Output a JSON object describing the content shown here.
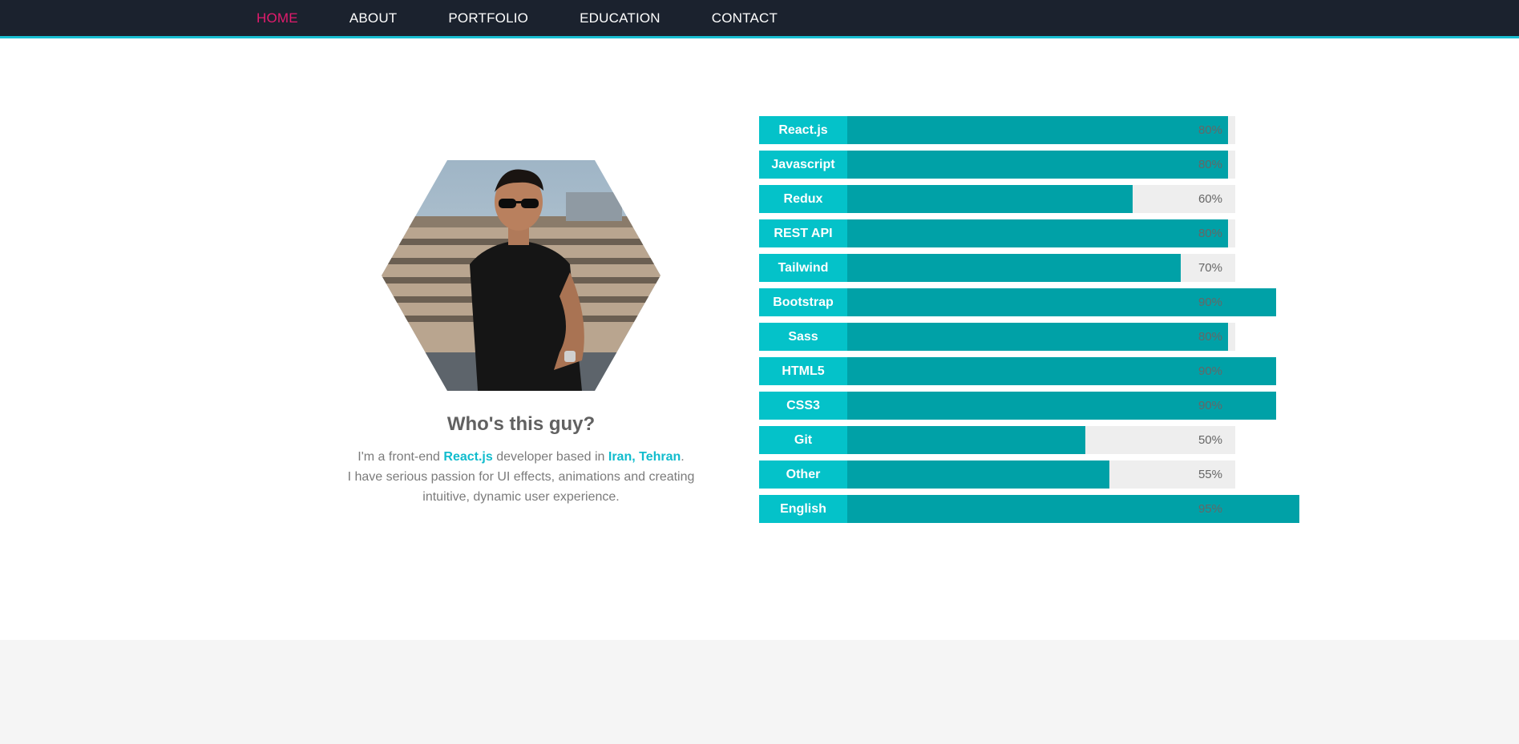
{
  "nav": {
    "items": [
      {
        "label": "HOME",
        "active": true
      },
      {
        "label": "ABOUT",
        "active": false
      },
      {
        "label": "PORTFOLIO",
        "active": false
      },
      {
        "label": "EDUCATION",
        "active": false
      },
      {
        "label": "CONTACT",
        "active": false
      }
    ]
  },
  "profile": {
    "title": "Who's this guy?",
    "bio": {
      "line1_pre": "I'm a front-end ",
      "tech": "React.js",
      "line1_mid": " developer based in ",
      "location": "Iran, Tehran",
      "line1_post": ".",
      "line2": "I have serious passion for UI effects, animations and creating intuitive, dynamic user experience."
    }
  },
  "skills": [
    {
      "name": "React.js",
      "percent": 80,
      "label": "80%"
    },
    {
      "name": "Javascript",
      "percent": 80,
      "label": "80%"
    },
    {
      "name": "Redux",
      "percent": 60,
      "label": "60%"
    },
    {
      "name": "REST API",
      "percent": 80,
      "label": "80%"
    },
    {
      "name": "Tailwind",
      "percent": 70,
      "label": "70%"
    },
    {
      "name": "Bootstrap",
      "percent": 90,
      "label": "90%"
    },
    {
      "name": "Sass",
      "percent": 80,
      "label": "80%"
    },
    {
      "name": "HTML5",
      "percent": 90,
      "label": "90%"
    },
    {
      "name": "CSS3",
      "percent": 90,
      "label": "90%"
    },
    {
      "name": "Git",
      "percent": 50,
      "label": "50%"
    },
    {
      "name": "Other",
      "percent": 55,
      "label": "55%"
    },
    {
      "name": "English",
      "percent": 95,
      "label": "95%"
    }
  ],
  "colors": {
    "nav_bg": "#1b222e",
    "accent": "#04c2c9",
    "accent_dark": "#00a1a7",
    "active_nav": "#e31b6d"
  }
}
